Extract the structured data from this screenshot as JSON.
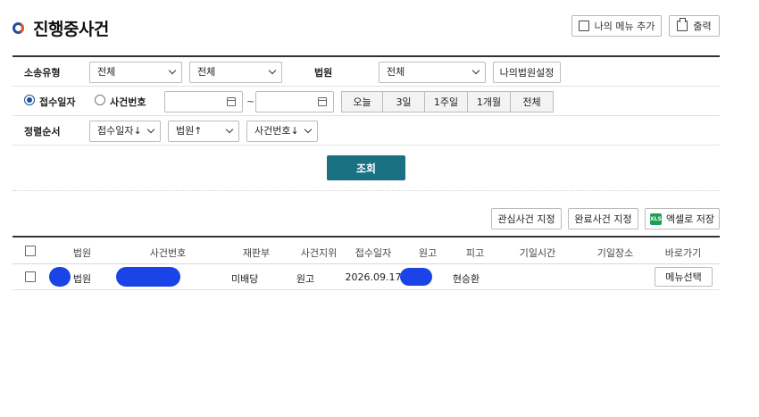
{
  "header": {
    "title": "진행중사건",
    "my_menu_add": "나의 메뉴 추가",
    "print": "출력"
  },
  "filter": {
    "case_type_label": "소송유형",
    "case_type_1": "전체",
    "case_type_2": "전체",
    "court_label": "법원",
    "court_value": "전체",
    "my_court_setting": "나의법원설정",
    "radio_receipt_date": "접수일자",
    "radio_case_number": "사건번호",
    "date_from": "",
    "date_separator": "~",
    "date_to": "",
    "periods": [
      "오늘",
      "3일",
      "1주일",
      "1개월",
      "전체"
    ],
    "sort_label": "정렬순서",
    "sort_1": "접수일자↓",
    "sort_2": "법원↑",
    "sort_3": "사건번호↓"
  },
  "search_button": "조회",
  "actions": {
    "interest_case": "관심사건 지정",
    "complete_case": "완료사건 지정",
    "excel_icon_text": "XLS",
    "excel_save": "엑셀로 저장"
  },
  "table": {
    "headers": [
      "법원",
      "사건번호",
      "재판부",
      "사건지위",
      "접수일자",
      "원고",
      "피고",
      "기일시간",
      "기일장소",
      "바로가기"
    ],
    "rows": [
      {
        "court": "법원",
        "case_number": "",
        "division": "미배당",
        "status": "원고",
        "receipt_date": "2026.09.17",
        "plaintiff": "",
        "defendant": "현승환",
        "hearing_time": "",
        "hearing_place": "",
        "shortcut": "메뉴선택"
      }
    ]
  },
  "colors": {
    "accent": "#1a7182",
    "brand_blue": "#1f4e9c",
    "brand_orange": "#e8591a",
    "redaction": "#1a44e8"
  }
}
